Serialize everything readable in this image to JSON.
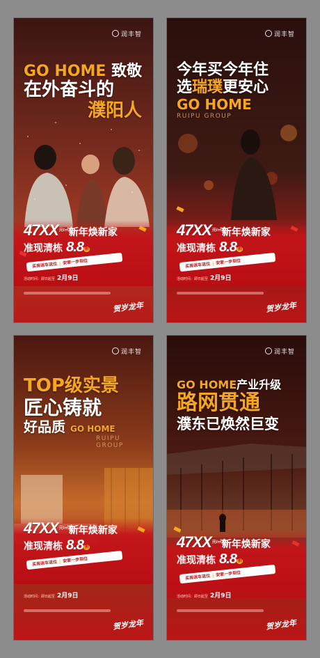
{
  "posters": [
    {
      "logo": "润丰智",
      "lines": [
        {
          "a": "GO HOME",
          "b": "致敬"
        },
        {
          "a": "在外奋斗的"
        },
        {
          "a": "濮阳人"
        }
      ],
      "promo": {
        "num": "47XX",
        "num_sub": "元/㎡起",
        "title": "新年焕新家",
        "sub_a": "准现清栋",
        "discount": "8.8",
        "discount_unit": "折",
        "ribbon_a": "买房送车送位",
        "ribbon_b": "安家一步到位"
      },
      "footer": {
        "label": "活动时间：即日起至",
        "date": "2月9日"
      },
      "newyear": "贺岁龙年"
    },
    {
      "logo": "润丰智",
      "lines": [
        {
          "a": "今年买今年住"
        },
        {
          "a": "选",
          "b": "瑞璞",
          "c": "更安心"
        },
        {
          "a": "GO HOME"
        }
      ],
      "en_tag": "RUIPU GROUP",
      "promo": {
        "num": "47XX",
        "num_sub": "元/㎡起",
        "title": "新年焕新家",
        "sub_a": "准现清栋",
        "discount": "8.8",
        "discount_unit": "折",
        "ribbon_a": "买房送车送位",
        "ribbon_b": "安家一步到位"
      },
      "footer": {
        "label": "活动时间：即日起至",
        "date": "2月9日"
      },
      "newyear": "贺岁龙年"
    },
    {
      "logo": "润丰智",
      "lines": [
        {
          "a": "TOP级实景"
        },
        {
          "a": "匠心铸就"
        },
        {
          "a": "好品质",
          "b": "GO HOME"
        }
      ],
      "en_tag": "RUIPU GROUP",
      "promo": {
        "num": "47XX",
        "num_sub": "元/㎡起",
        "title": "新年焕新家",
        "sub_a": "准现清栋",
        "discount": "8.8",
        "discount_unit": "折",
        "ribbon_a": "买房送车送位",
        "ribbon_b": "安家一步到位"
      },
      "footer": {
        "label": "活动时间：即日起至",
        "date": "2月9日"
      },
      "newyear": "贺岁龙年"
    },
    {
      "logo": "润丰智",
      "lines": [
        {
          "a": "GO HOME",
          "b": "产业升级"
        },
        {
          "a": "路网贯通"
        },
        {
          "a": "濮东已焕然巨变"
        }
      ],
      "promo": {
        "num": "47XX",
        "num_sub": "元/㎡起",
        "title": "新年焕新家",
        "sub_a": "准现清栋",
        "discount": "8.8",
        "discount_unit": "折",
        "ribbon_a": "买房送车送位",
        "ribbon_b": "安家一步到位"
      },
      "footer": {
        "label": "活动时间：即日起至",
        "date": "2月9日"
      },
      "newyear": "贺岁龙年"
    }
  ],
  "colors": {
    "accent": "#f5a623",
    "brand_red": "#c0141a",
    "page_bg": "#8c8c8c"
  }
}
